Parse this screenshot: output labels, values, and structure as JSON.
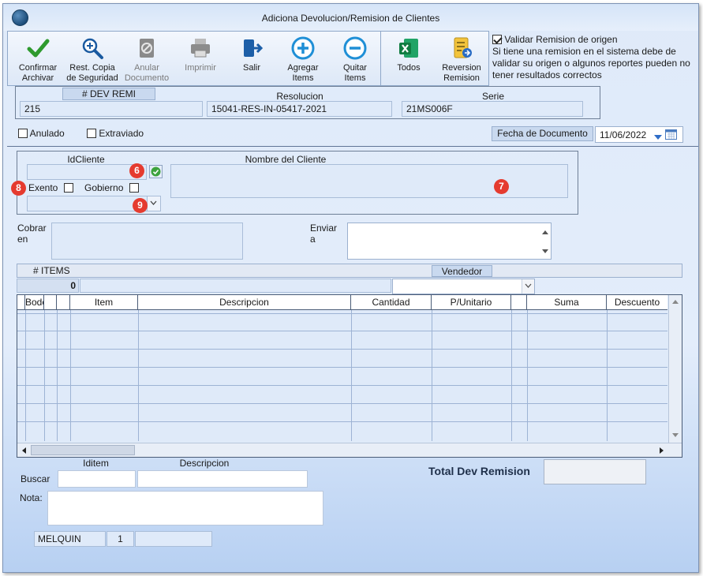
{
  "window": {
    "title": "Adiciona Devolucion/Remision de Clientes"
  },
  "toolbar": {
    "confirm": "Confirmar\nArchivar",
    "restore": "Rest. Copia\nde Seguridad",
    "cancel_doc": "Anular\nDocumento",
    "print": "Imprimir",
    "exit": "Salir",
    "add_items": "Agregar\nItems",
    "remove_items": "Quitar\nItems",
    "all": "Todos",
    "reversal": "Reversion\nRemision"
  },
  "validate": {
    "label": "Validar Remision de origen",
    "checked": true,
    "note": "Si tiene una remision en el sistema debe de validar su origen o algunos reportes pueden no tener resultados correctos"
  },
  "doc": {
    "dev_remi_label": "# DEV REMI",
    "dev_remi_value": "215",
    "resolucion_label": "Resolucion",
    "resolucion_value": "15041-RES-IN-05417-2021",
    "serie_label": "Serie",
    "serie_value": "21MS006F"
  },
  "flags": {
    "anulado": "Anulado",
    "extraviado": "Extraviado"
  },
  "fecha": {
    "label": "Fecha de  Documento",
    "value": "11/06/2022"
  },
  "client": {
    "id_label": "IdCliente",
    "name_label": "Nombre del Cliente",
    "exento": "Exento",
    "gobierno": "Gobierno",
    "badges": [
      "6",
      "7",
      "8",
      "9"
    ]
  },
  "cobrar": {
    "label_a": "Cobrar",
    "label_b": "en"
  },
  "enviar": {
    "label_a": "Enviar",
    "label_b": "a"
  },
  "items": {
    "count_label": "# ITEMS",
    "count_value": "0",
    "vendedor_label": "Vendedor"
  },
  "grid": {
    "columns": [
      "",
      "Bodega",
      "",
      "",
      "Item",
      "Descripcion",
      "Cantidad",
      "P/Unitario",
      "",
      "Suma",
      "Descuento"
    ]
  },
  "search": {
    "iditem_label": "Iditem",
    "desc_label": "Descripcion",
    "buscar_label": "Buscar",
    "nota_label": "Nota:"
  },
  "total": {
    "label": "Total Dev Remision"
  },
  "footer": {
    "user": "MELQUIN",
    "number": "1"
  }
}
